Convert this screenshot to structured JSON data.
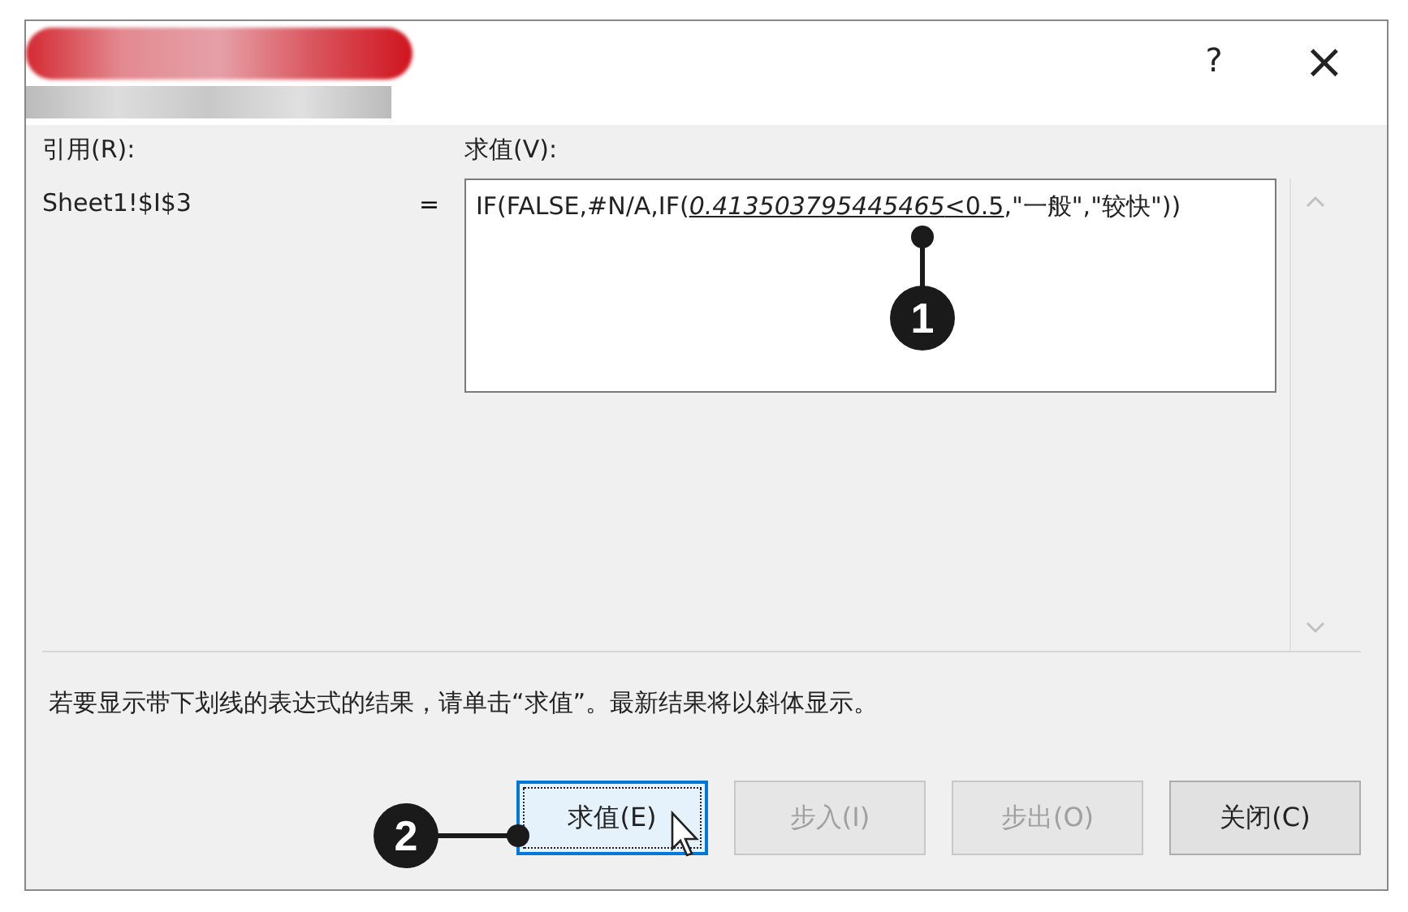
{
  "window": {
    "help": "?",
    "close": "×"
  },
  "reference": {
    "label": "引用(R):",
    "value": "Sheet1!$I$3",
    "equals": "="
  },
  "evaluation": {
    "label": "求值(V):",
    "segments": [
      {
        "text": "IF(FALSE,#N/A,IF(",
        "underlined": false,
        "italic": false
      },
      {
        "text": "0.413503795445465",
        "underlined": true,
        "italic": true
      },
      {
        "text": "<0.5",
        "underlined": true,
        "italic": false
      },
      {
        "text": ",\"一般\",\"较快\"))",
        "underlined": false,
        "italic": false
      }
    ]
  },
  "hint": "若要显示带下划线的表达式的结果，请单击“求值”。最新结果将以斜体显示。",
  "buttons": [
    {
      "label": "求值(E)",
      "disabled": false,
      "focused": true
    },
    {
      "label": "步入(I)",
      "disabled": true,
      "focused": false
    },
    {
      "label": "步出(O)",
      "disabled": true,
      "focused": false
    },
    {
      "label": "关闭(C)",
      "disabled": false,
      "focused": false
    }
  ],
  "callouts": [
    "1",
    "2"
  ]
}
